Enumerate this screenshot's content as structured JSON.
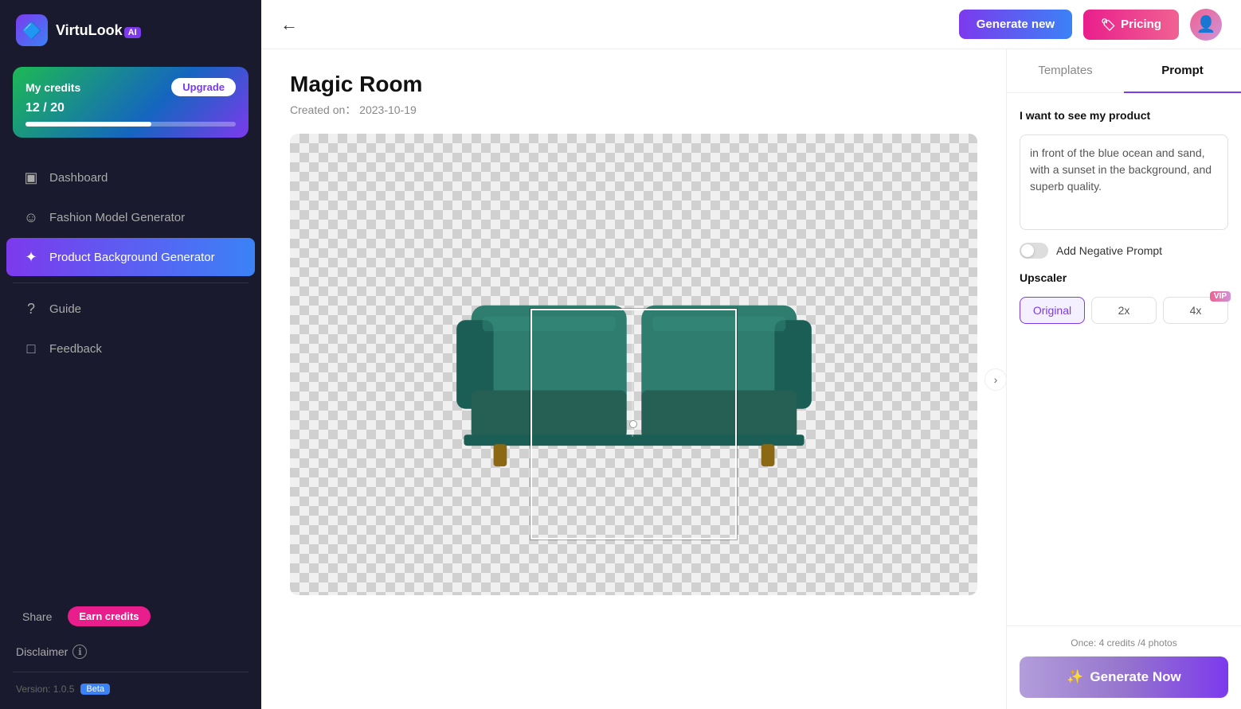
{
  "sidebar": {
    "logo_text": "VirtuLook",
    "logo_ai": "AI",
    "credits": {
      "label": "My credits",
      "upgrade_btn": "Upgrade",
      "amount": "12 / 20",
      "fill_percent": 60
    },
    "nav_items": [
      {
        "id": "dashboard",
        "label": "Dashboard",
        "icon": "▣",
        "active": false
      },
      {
        "id": "fashion-model",
        "label": "Fashion Model Generator",
        "icon": "☺",
        "active": false
      },
      {
        "id": "product-bg",
        "label": "Product Background Generator",
        "icon": "✦",
        "active": true
      }
    ],
    "bottom_items": [
      {
        "id": "guide",
        "label": "Guide",
        "icon": "?"
      },
      {
        "id": "feedback",
        "label": "Feedback",
        "icon": "□"
      }
    ],
    "earn_credits_btn": "Earn credits",
    "disclaimer_label": "Disclaimer",
    "version_label": "Version: 1.0.5",
    "beta_badge": "Beta"
  },
  "topbar": {
    "generate_new_btn": "Generate new",
    "pricing_btn": "Pricing"
  },
  "main": {
    "page_title": "Magic Room",
    "page_meta_prefix": "Created on：",
    "page_meta_date": "2023-10-19"
  },
  "right_panel": {
    "tabs": [
      {
        "id": "templates",
        "label": "Templates"
      },
      {
        "id": "prompt",
        "label": "Prompt",
        "active": true
      }
    ],
    "prompt_heading": "I want to see my product",
    "prompt_placeholder": "in front of the blue ocean and sand, with a sunset in the background, and superb quality.",
    "negative_prompt_label": "Add Negative Prompt",
    "upscaler_label": "Upscaler",
    "upscaler_options": [
      {
        "id": "original",
        "label": "Original",
        "active": true
      },
      {
        "id": "2x",
        "label": "2x",
        "active": false
      },
      {
        "id": "4x",
        "label": "4x",
        "active": false,
        "vip": true
      }
    ],
    "credit_note": "Once: 4 credits /4 photos",
    "generate_now_btn": "Generate Now"
  }
}
